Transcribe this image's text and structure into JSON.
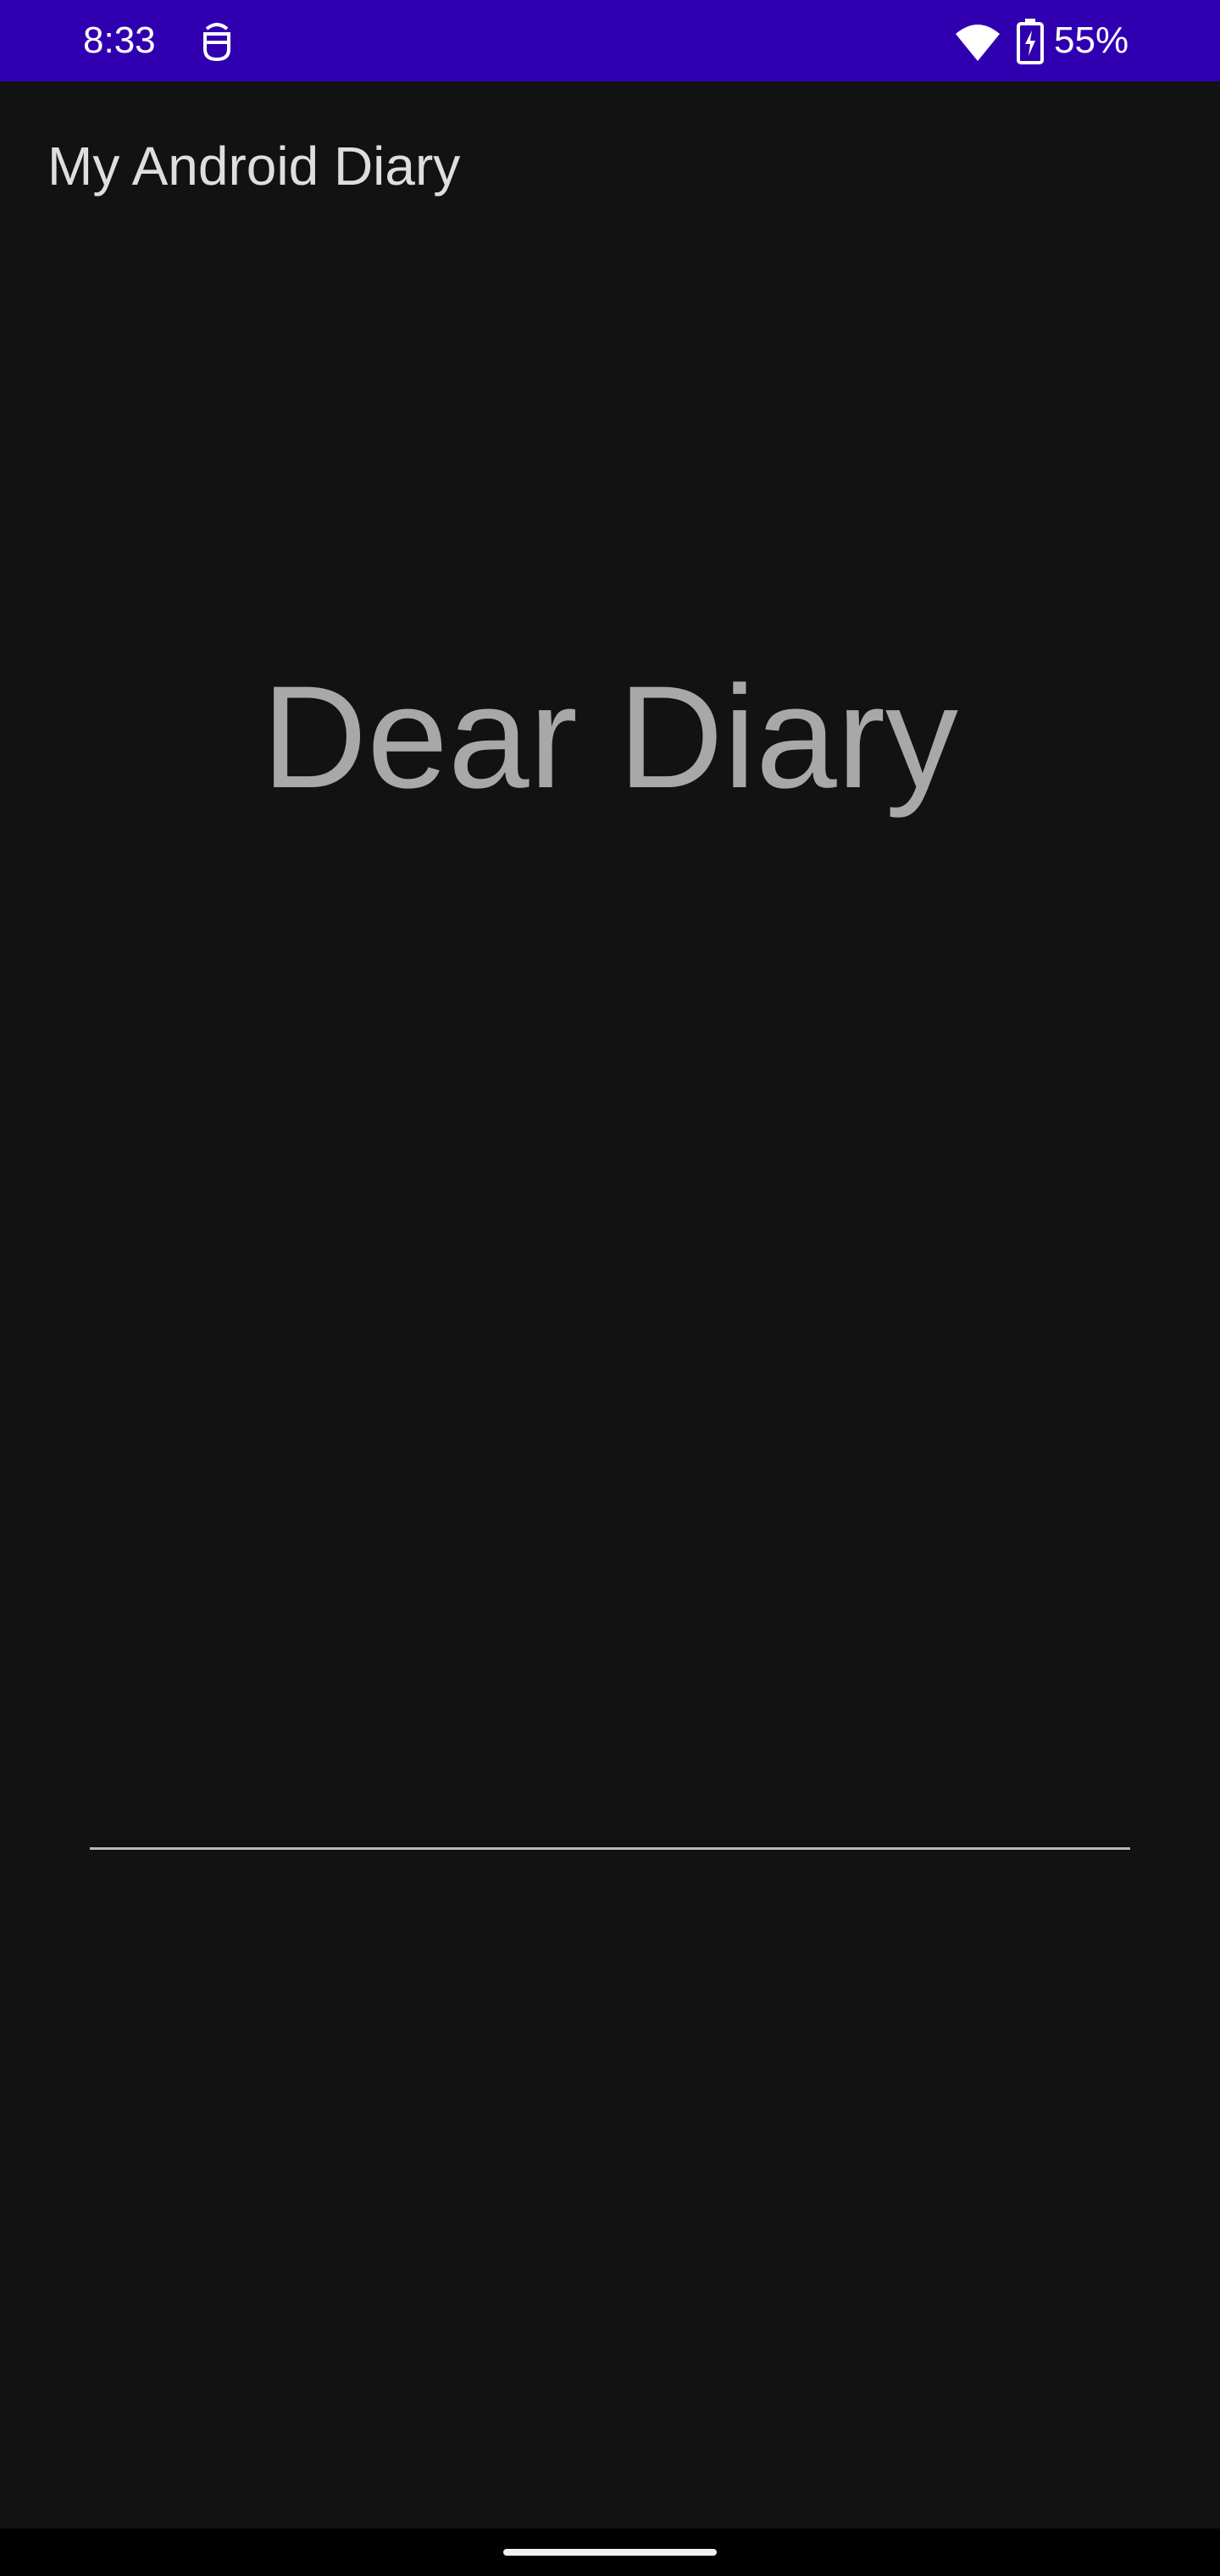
{
  "status_bar": {
    "time": "8:33",
    "battery_percent": "55%",
    "background_color": "#3000b0",
    "icons": [
      "notification-icon",
      "wifi-icon",
      "battery-charging-icon"
    ]
  },
  "app_bar": {
    "title": "My Android Diary"
  },
  "main": {
    "headline": "Dear Diary",
    "entry_input": {
      "value": "",
      "placeholder": ""
    }
  },
  "nav_bar": {
    "handle": "home-gesture-handle"
  },
  "colors": {
    "background": "#121212",
    "title_text": "#dedede",
    "headline_text": "#a8a8a8",
    "underline": "#b8b8b8"
  }
}
